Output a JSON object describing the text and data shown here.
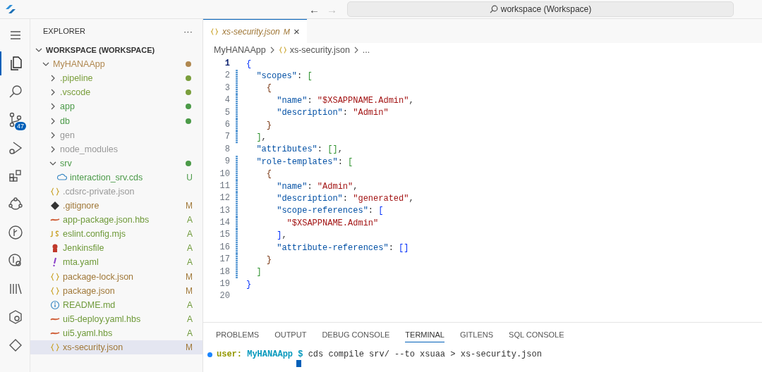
{
  "title_bar": {
    "back": "←",
    "forward": "→",
    "forward_disabled": true,
    "search": "workspace (Workspace)"
  },
  "activity_bar": [
    {
      "kind": "menu",
      "selected": false
    },
    {
      "kind": "files",
      "selected": true
    },
    {
      "kind": "search",
      "selected": false
    },
    {
      "kind": "source-control",
      "selected": false,
      "badge": "47"
    },
    {
      "kind": "debug",
      "selected": false
    },
    {
      "kind": "extensions",
      "selected": false
    },
    {
      "kind": "nodes",
      "selected": false
    },
    {
      "kind": "git-graph",
      "selected": false
    },
    {
      "kind": "git-search",
      "selected": false
    },
    {
      "kind": "library",
      "selected": false
    },
    {
      "kind": "cube",
      "selected": false
    },
    {
      "kind": "diamond",
      "selected": false
    }
  ],
  "explorer": {
    "title": "EXPLORER",
    "more": "···",
    "tree": [
      {
        "label": "WORKSPACE (WORKSPACE)",
        "kind": "root",
        "expanded": true,
        "children": [
          {
            "label": "MyHANAApp",
            "kind": "folder",
            "expanded": true,
            "color": "#b08850",
            "dot": true,
            "children": [
              {
                "label": ".pipeline",
                "kind": "folder",
                "expanded": false,
                "color": "#7a9e3c",
                "dot": true
              },
              {
                "label": ".vscode",
                "kind": "folder",
                "expanded": false,
                "color": "#7a9e3c",
                "dot": true
              },
              {
                "label": "app",
                "kind": "folder",
                "expanded": false,
                "color": "#4b9a48",
                "dot": true
              },
              {
                "label": "db",
                "kind": "folder",
                "expanded": false,
                "color": "#4b9a48",
                "dot": true
              },
              {
                "label": "gen",
                "kind": "folder",
                "expanded": false,
                "color": "#9a9a9a",
                "dot": false
              },
              {
                "label": "node_modules",
                "kind": "folder",
                "expanded": false,
                "color": "#9a9a9a",
                "dot": false
              },
              {
                "label": "srv",
                "kind": "folder",
                "expanded": true,
                "color": "#4b9a48",
                "dot": true,
                "children": [
                  {
                    "label": "interaction_srv.cds",
                    "kind": "cds",
                    "color": "#4b9a48",
                    "status": "U",
                    "selected": false
                  }
                ]
              },
              {
                "label": ".cdsrc-private.json",
                "kind": "json",
                "color": "#9a9a9a",
                "selected": false
              },
              {
                "label": ".gitignore",
                "kind": "git",
                "color": "#a07838",
                "status": "M",
                "selected": false
              },
              {
                "label": "app-package.json.hbs",
                "kind": "hbs",
                "color": "#6f9a3a",
                "status": "A",
                "selected": false
              },
              {
                "label": "eslint.config.mjs",
                "kind": "js",
                "color": "#6f9a3a",
                "status": "A",
                "selected": false
              },
              {
                "label": "Jenkinsfile",
                "kind": "jenkins",
                "color": "#6f9a3a",
                "status": "A",
                "selected": false
              },
              {
                "label": "mta.yaml",
                "kind": "yaml",
                "color": "#6f9a3a",
                "status": "A",
                "selected": false
              },
              {
                "label": "package-lock.json",
                "kind": "json",
                "color": "#a07838",
                "status": "M",
                "selected": false
              },
              {
                "label": "package.json",
                "kind": "json",
                "color": "#a07838",
                "status": "M",
                "selected": false
              },
              {
                "label": "README.md",
                "kind": "md",
                "color": "#6f9a3a",
                "status": "A",
                "selected": false
              },
              {
                "label": "ui5-deploy.yaml.hbs",
                "kind": "hbs",
                "color": "#6f9a3a",
                "status": "A",
                "selected": false
              },
              {
                "label": "ui5.yaml.hbs",
                "kind": "hbs",
                "color": "#6f9a3a",
                "status": "A",
                "selected": false
              },
              {
                "label": "xs-security.json",
                "kind": "json",
                "color": "#a07838",
                "status": "M",
                "selected": true
              }
            ]
          }
        ]
      }
    ]
  },
  "editor": {
    "tabs": [
      {
        "label": "xs-security.json",
        "status": "M",
        "close": "×",
        "selected": true
      }
    ],
    "breadcrumb": [
      "MyHANAApp",
      "xs-security.json",
      "..."
    ],
    "lines": [
      {
        "number": "1",
        "active": true,
        "changed": false,
        "tokens": [
          {
            "kind": "b1",
            "text": "{"
          }
        ]
      },
      {
        "number": "2",
        "active": false,
        "changed": true,
        "tokens": [
          {
            "kind": "key",
            "text": "  \"scopes\""
          },
          {
            "kind": "punct",
            "text": ": "
          },
          {
            "kind": "b2",
            "text": "["
          }
        ]
      },
      {
        "number": "3",
        "active": false,
        "changed": true,
        "tokens": [
          {
            "kind": "b3",
            "text": "    {"
          }
        ]
      },
      {
        "number": "4",
        "active": false,
        "changed": true,
        "tokens": [
          {
            "kind": "key",
            "text": "      \"name\""
          },
          {
            "kind": "punct",
            "text": ": "
          },
          {
            "kind": "str",
            "text": "\"$XSAPPNAME.Admin\""
          },
          {
            "kind": "punct",
            "text": ","
          }
        ]
      },
      {
        "number": "5",
        "active": false,
        "changed": true,
        "tokens": [
          {
            "kind": "key",
            "text": "      \"description\""
          },
          {
            "kind": "punct",
            "text": ": "
          },
          {
            "kind": "str",
            "text": "\"Admin\""
          }
        ]
      },
      {
        "number": "6",
        "active": false,
        "changed": true,
        "tokens": [
          {
            "kind": "b3",
            "text": "    }"
          }
        ]
      },
      {
        "number": "7",
        "active": false,
        "changed": true,
        "tokens": [
          {
            "kind": "b2",
            "text": "  ]"
          },
          {
            "kind": "punct",
            "text": ","
          }
        ]
      },
      {
        "number": "8",
        "active": false,
        "changed": false,
        "tokens": [
          {
            "kind": "key",
            "text": "  \"attributes\""
          },
          {
            "kind": "punct",
            "text": ": "
          },
          {
            "kind": "b2",
            "text": "[]"
          },
          {
            "kind": "punct",
            "text": ","
          }
        ]
      },
      {
        "number": "9",
        "active": false,
        "changed": true,
        "tokens": [
          {
            "kind": "key",
            "text": "  \"role-templates\""
          },
          {
            "kind": "punct",
            "text": ": "
          },
          {
            "kind": "b2",
            "text": "["
          }
        ]
      },
      {
        "number": "10",
        "active": false,
        "changed": true,
        "tokens": [
          {
            "kind": "b3",
            "text": "    {"
          }
        ]
      },
      {
        "number": "11",
        "active": false,
        "changed": true,
        "tokens": [
          {
            "kind": "key",
            "text": "      \"name\""
          },
          {
            "kind": "punct",
            "text": ": "
          },
          {
            "kind": "str",
            "text": "\"Admin\""
          },
          {
            "kind": "punct",
            "text": ","
          }
        ]
      },
      {
        "number": "12",
        "active": false,
        "changed": true,
        "tokens": [
          {
            "kind": "key",
            "text": "      \"description\""
          },
          {
            "kind": "punct",
            "text": ": "
          },
          {
            "kind": "str",
            "text": "\"generated\""
          },
          {
            "kind": "punct",
            "text": ","
          }
        ]
      },
      {
        "number": "13",
        "active": false,
        "changed": true,
        "tokens": [
          {
            "kind": "key",
            "text": "      \"scope-references\""
          },
          {
            "kind": "punct",
            "text": ": "
          },
          {
            "kind": "b1",
            "text": "["
          }
        ]
      },
      {
        "number": "14",
        "active": false,
        "changed": true,
        "tokens": [
          {
            "kind": "str",
            "text": "        \"$XSAPPNAME.Admin\""
          }
        ]
      },
      {
        "number": "15",
        "active": false,
        "changed": true,
        "tokens": [
          {
            "kind": "b1",
            "text": "      ]"
          },
          {
            "kind": "punct",
            "text": ","
          }
        ]
      },
      {
        "number": "16",
        "active": false,
        "changed": true,
        "tokens": [
          {
            "kind": "key",
            "text": "      \"attribute-references\""
          },
          {
            "kind": "punct",
            "text": ": "
          },
          {
            "kind": "b1",
            "text": "[]"
          }
        ]
      },
      {
        "number": "17",
        "active": false,
        "changed": true,
        "tokens": [
          {
            "kind": "b3",
            "text": "    }"
          }
        ]
      },
      {
        "number": "18",
        "active": false,
        "changed": true,
        "tokens": [
          {
            "kind": "b2",
            "text": "  ]"
          }
        ]
      },
      {
        "number": "19",
        "active": false,
        "changed": false,
        "tokens": [
          {
            "kind": "b1",
            "text": "}"
          }
        ]
      },
      {
        "number": "20",
        "active": false,
        "changed": false
      }
    ]
  },
  "panel": {
    "tabs": [
      {
        "label": "PROBLEMS",
        "selected": false
      },
      {
        "label": "OUTPUT",
        "selected": false
      },
      {
        "label": "DEBUG CONSOLE",
        "selected": false
      },
      {
        "label": "TERMINAL",
        "selected": true
      },
      {
        "label": "GITLENS",
        "selected": false
      },
      {
        "label": "SQL CONSOLE",
        "selected": false
      }
    ],
    "terminal": {
      "user": "user:",
      "path": "MyHANAApp",
      "prompt": "$",
      "command": "cds compile srv/ --to xsuaa > xs-security.json",
      "cursor": true
    }
  }
}
